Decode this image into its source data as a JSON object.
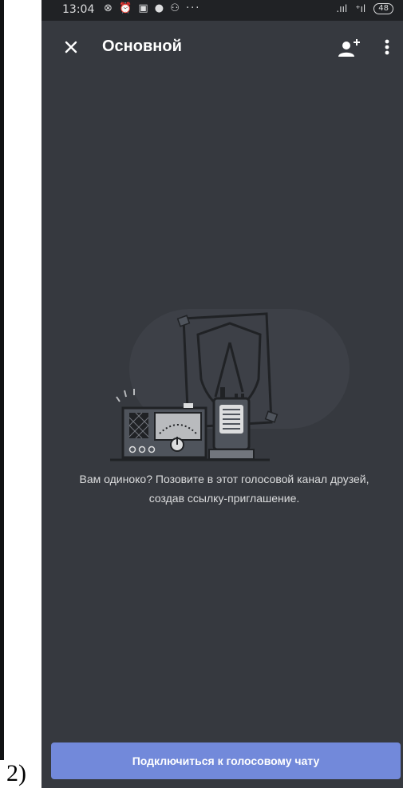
{
  "document": {
    "label": "2)"
  },
  "status_bar": {
    "time": "13:04",
    "left_icons": "⊗ ⏰ ▣ ● ⚇ ···",
    "signal": ".ııl",
    "wifi": "⁺ıl",
    "battery": "48"
  },
  "toolbar": {
    "close_icon": "close-icon",
    "title": "Основной",
    "add_user_icon": "add-user-icon",
    "more_icon": "more-vertical-icon"
  },
  "empty_state": {
    "illustration": "radio-walkie-talkie-shield-illustration",
    "text_line1": "Вам одиноко? Позовите в этот голосовой канал друзей,",
    "text_line2": "создав ссылку-приглашение."
  },
  "actions": {
    "connect_label": "Подключиться к голосовому чату"
  },
  "colors": {
    "background": "#36393f",
    "status_bar": "#202225",
    "accent": "#7289da",
    "text_primary": "#ffffff",
    "text_secondary": "#dcddde"
  }
}
